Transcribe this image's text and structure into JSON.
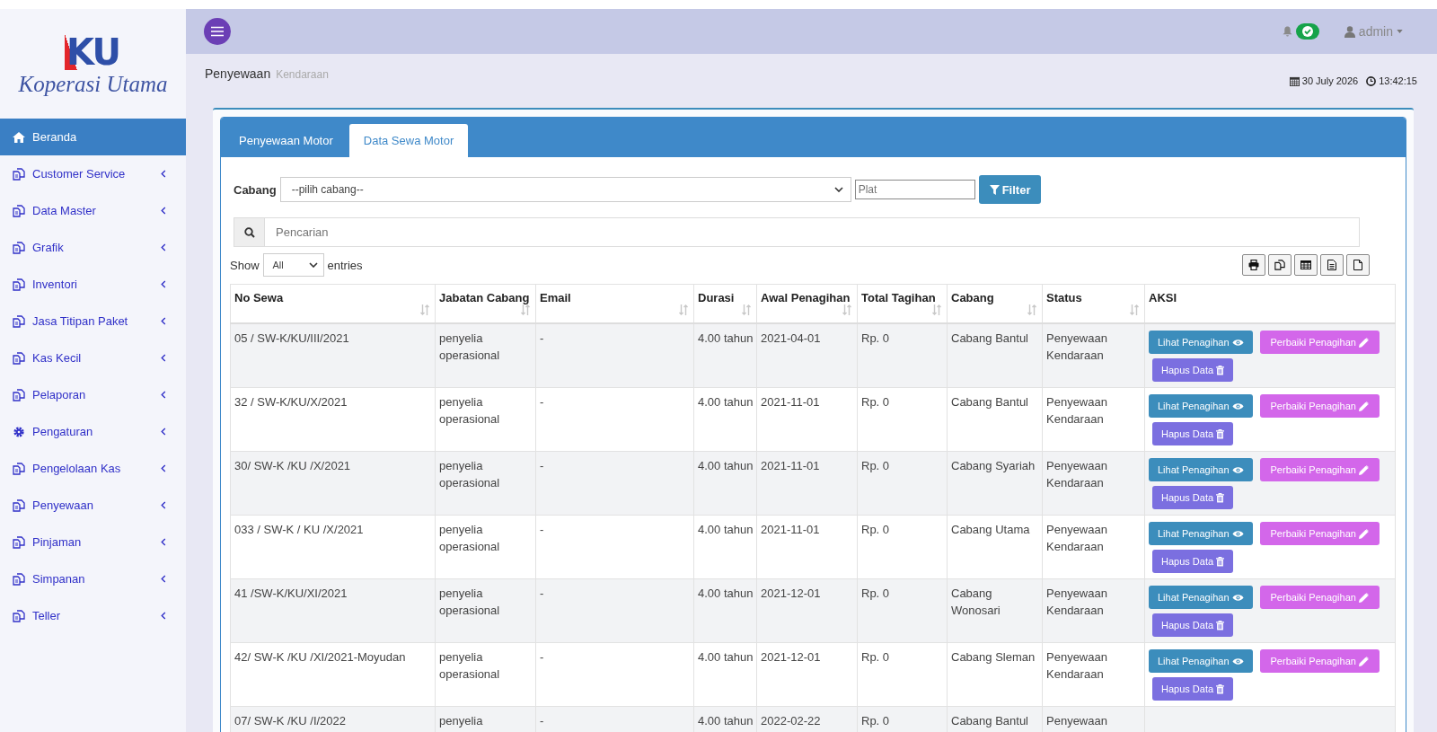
{
  "sidebar": {
    "logo": {
      "mark": "KU",
      "name": "Koperasi Utama"
    },
    "items": [
      {
        "label": "Beranda",
        "kind": "home",
        "selected": true,
        "expandable": false
      },
      {
        "label": "Customer Service",
        "kind": "copy",
        "selected": false,
        "expandable": true
      },
      {
        "label": "Data Master",
        "kind": "copy",
        "selected": false,
        "expandable": true
      },
      {
        "label": "Grafik",
        "kind": "copy",
        "selected": false,
        "expandable": true
      },
      {
        "label": "Inventori",
        "kind": "copy",
        "selected": false,
        "expandable": true
      },
      {
        "label": "Jasa Titipan Paket",
        "kind": "copy",
        "selected": false,
        "expandable": true
      },
      {
        "label": "Kas Kecil",
        "kind": "copy",
        "selected": false,
        "expandable": true
      },
      {
        "label": "Pelaporan",
        "kind": "copy",
        "selected": false,
        "expandable": true
      },
      {
        "label": "Pengaturan",
        "kind": "gear",
        "selected": false,
        "expandable": true
      },
      {
        "label": "Pengelolaan Kas",
        "kind": "copy",
        "selected": false,
        "expandable": true
      },
      {
        "label": "Penyewaan",
        "kind": "copy",
        "selected": false,
        "expandable": true
      },
      {
        "label": "Pinjaman",
        "kind": "copy",
        "selected": false,
        "expandable": true
      },
      {
        "label": "Simpanan",
        "kind": "copy",
        "selected": false,
        "expandable": true
      },
      {
        "label": "Teller",
        "kind": "copy",
        "selected": false,
        "expandable": true
      }
    ]
  },
  "topbar": {
    "user": "admin"
  },
  "header": {
    "title": "Penyewaan",
    "subtitle": "Kendaraan",
    "date": "30 July 2026",
    "time": "13:42:15"
  },
  "tabs": [
    {
      "label": "Penyewaan Motor",
      "selected": false
    },
    {
      "label": "Data Sewa Motor",
      "selected": true
    }
  ],
  "filter": {
    "label": "Cabang",
    "select_value": "--pilih cabang--",
    "plate_placeholder": "Plat",
    "button": "Filter"
  },
  "search": {
    "placeholder": "Pencarian"
  },
  "length": {
    "prefix": "Show",
    "value": "All",
    "suffix": "entries"
  },
  "export_buttons": [
    {
      "kind": "print"
    },
    {
      "kind": "copy"
    },
    {
      "kind": "table"
    },
    {
      "kind": "file-text"
    },
    {
      "kind": "file"
    }
  ],
  "table": {
    "columns": [
      {
        "label": "No Sewa",
        "sortable": true
      },
      {
        "label": "Jabatan Cabang",
        "sortable": true
      },
      {
        "label": "Email",
        "sortable": true
      },
      {
        "label": "Durasi",
        "sortable": true
      },
      {
        "label": "Awal Penagihan",
        "sortable": true
      },
      {
        "label": "Total Tagihan",
        "sortable": true
      },
      {
        "label": "Cabang",
        "sortable": true
      },
      {
        "label": "Status",
        "sortable": true
      },
      {
        "label": "AKSI",
        "sortable": false
      }
    ],
    "rows": [
      {
        "cells": [
          "05 / SW-K/KU/III/2021",
          "penyelia operasional",
          "-",
          "4.00 tahun",
          "2021-04-01",
          "Rp. 0",
          "Cabang Bantul",
          "Penyewaan Kendaraan"
        ],
        "actions": [
          {
            "label": "Lihat Penagihan",
            "kind": "view"
          },
          {
            "label": "Perbaiki Penagihan",
            "kind": "edit"
          },
          {
            "label": "Hapus Data",
            "kind": "delete"
          }
        ]
      },
      {
        "cells": [
          "32 / SW-K/KU/X/2021",
          "penyelia operasional",
          "-",
          "4.00 tahun",
          "2021-11-01",
          "Rp. 0",
          "Cabang Bantul",
          "Penyewaan Kendaraan"
        ],
        "actions": [
          {
            "label": "Lihat Penagihan",
            "kind": "view"
          },
          {
            "label": "Perbaiki Penagihan",
            "kind": "edit"
          },
          {
            "label": "Hapus Data",
            "kind": "delete"
          }
        ]
      },
      {
        "cells": [
          "30/ SW-K /KU /X/2021",
          "penyelia operasional",
          "-",
          "4.00 tahun",
          "2021-11-01",
          "Rp. 0",
          "Cabang Syariah",
          "Penyewaan Kendaraan"
        ],
        "actions": [
          {
            "label": "Lihat Penagihan",
            "kind": "view"
          },
          {
            "label": "Perbaiki Penagihan",
            "kind": "edit"
          },
          {
            "label": "Hapus Data",
            "kind": "delete"
          }
        ]
      },
      {
        "cells": [
          "033 / SW-K / KU /X/2021",
          "penyelia operasional",
          "-",
          "4.00 tahun",
          "2021-11-01",
          "Rp. 0",
          "Cabang Utama",
          "Penyewaan Kendaraan"
        ],
        "actions": [
          {
            "label": "Lihat Penagihan",
            "kind": "view"
          },
          {
            "label": "Perbaiki Penagihan",
            "kind": "edit"
          },
          {
            "label": "Hapus Data",
            "kind": "delete"
          }
        ]
      },
      {
        "cells": [
          "41 /SW-K/KU/XI/2021",
          "penyelia operasional",
          "-",
          "4.00 tahun",
          "2021-12-01",
          "Rp. 0",
          "Cabang Wonosari",
          "Penyewaan Kendaraan"
        ],
        "actions": [
          {
            "label": "Lihat Penagihan",
            "kind": "view"
          },
          {
            "label": "Perbaiki Penagihan",
            "kind": "edit"
          },
          {
            "label": "Hapus Data",
            "kind": "delete"
          }
        ]
      },
      {
        "cells": [
          "42/ SW-K /KU /XI/2021-Moyudan",
          "penyelia operasional",
          "-",
          "4.00 tahun",
          "2021-12-01",
          "Rp. 0",
          "Cabang Sleman",
          "Penyewaan Kendaraan"
        ],
        "actions": [
          {
            "label": "Lihat Penagihan",
            "kind": "view"
          },
          {
            "label": "Perbaiki Penagihan",
            "kind": "edit"
          },
          {
            "label": "Hapus Data",
            "kind": "delete"
          }
        ]
      },
      {
        "cells": [
          "07/ SW-K /KU /I/2022",
          "penyelia",
          "-",
          "4.00 tahun",
          "2022-02-22",
          "Rp. 0",
          "Cabang Bantul",
          "Penyewaan"
        ],
        "actions": []
      }
    ]
  }
}
